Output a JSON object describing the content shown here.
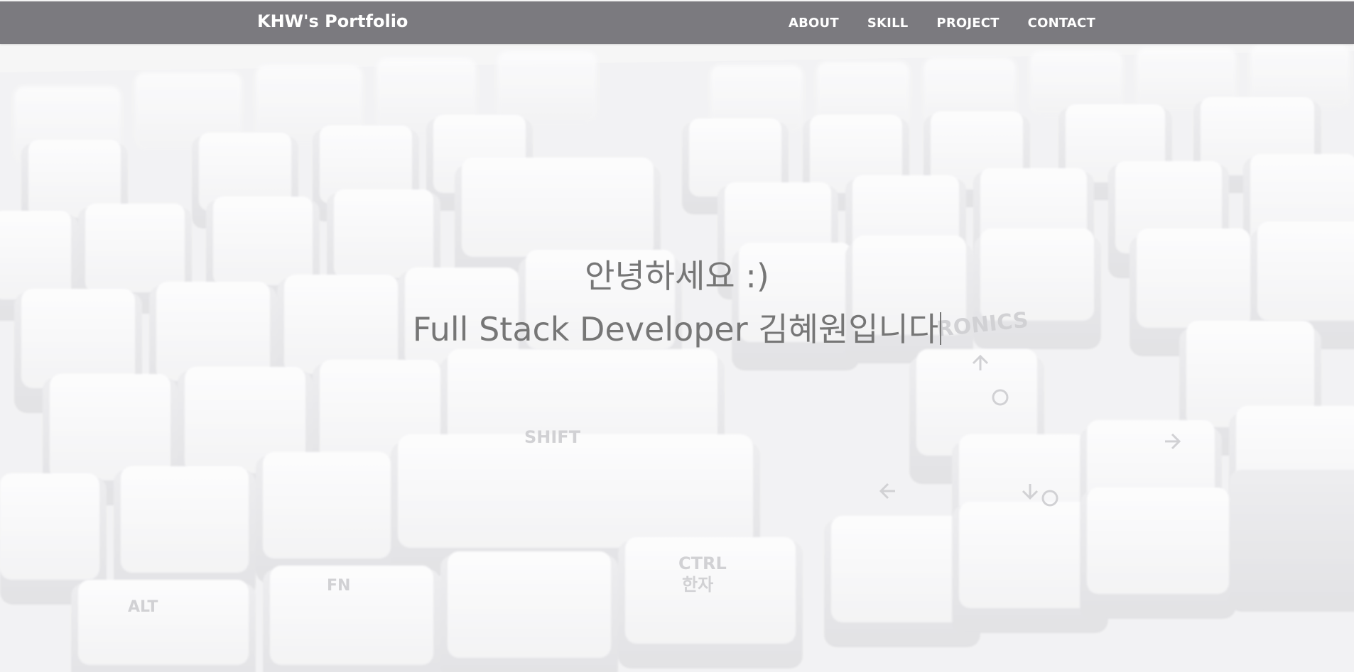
{
  "navbar": {
    "brand": "KHW's Portfolio",
    "links": [
      {
        "label": "ABOUT"
      },
      {
        "label": "SKILL"
      },
      {
        "label": "PROJECT"
      },
      {
        "label": "CONTACT"
      }
    ],
    "background_color": "#7b7a7f",
    "text_color": "#ffffff"
  },
  "hero": {
    "greeting": "안녕하세요 :)",
    "intro": "Full Stack Developer 김혜원입니다",
    "text_color": "#767676",
    "background_image": "white-keyboard-photo",
    "key_legends": [
      "SHIFT",
      "CTRL",
      "한자",
      "FN",
      "ALT",
      "RONICS"
    ]
  }
}
